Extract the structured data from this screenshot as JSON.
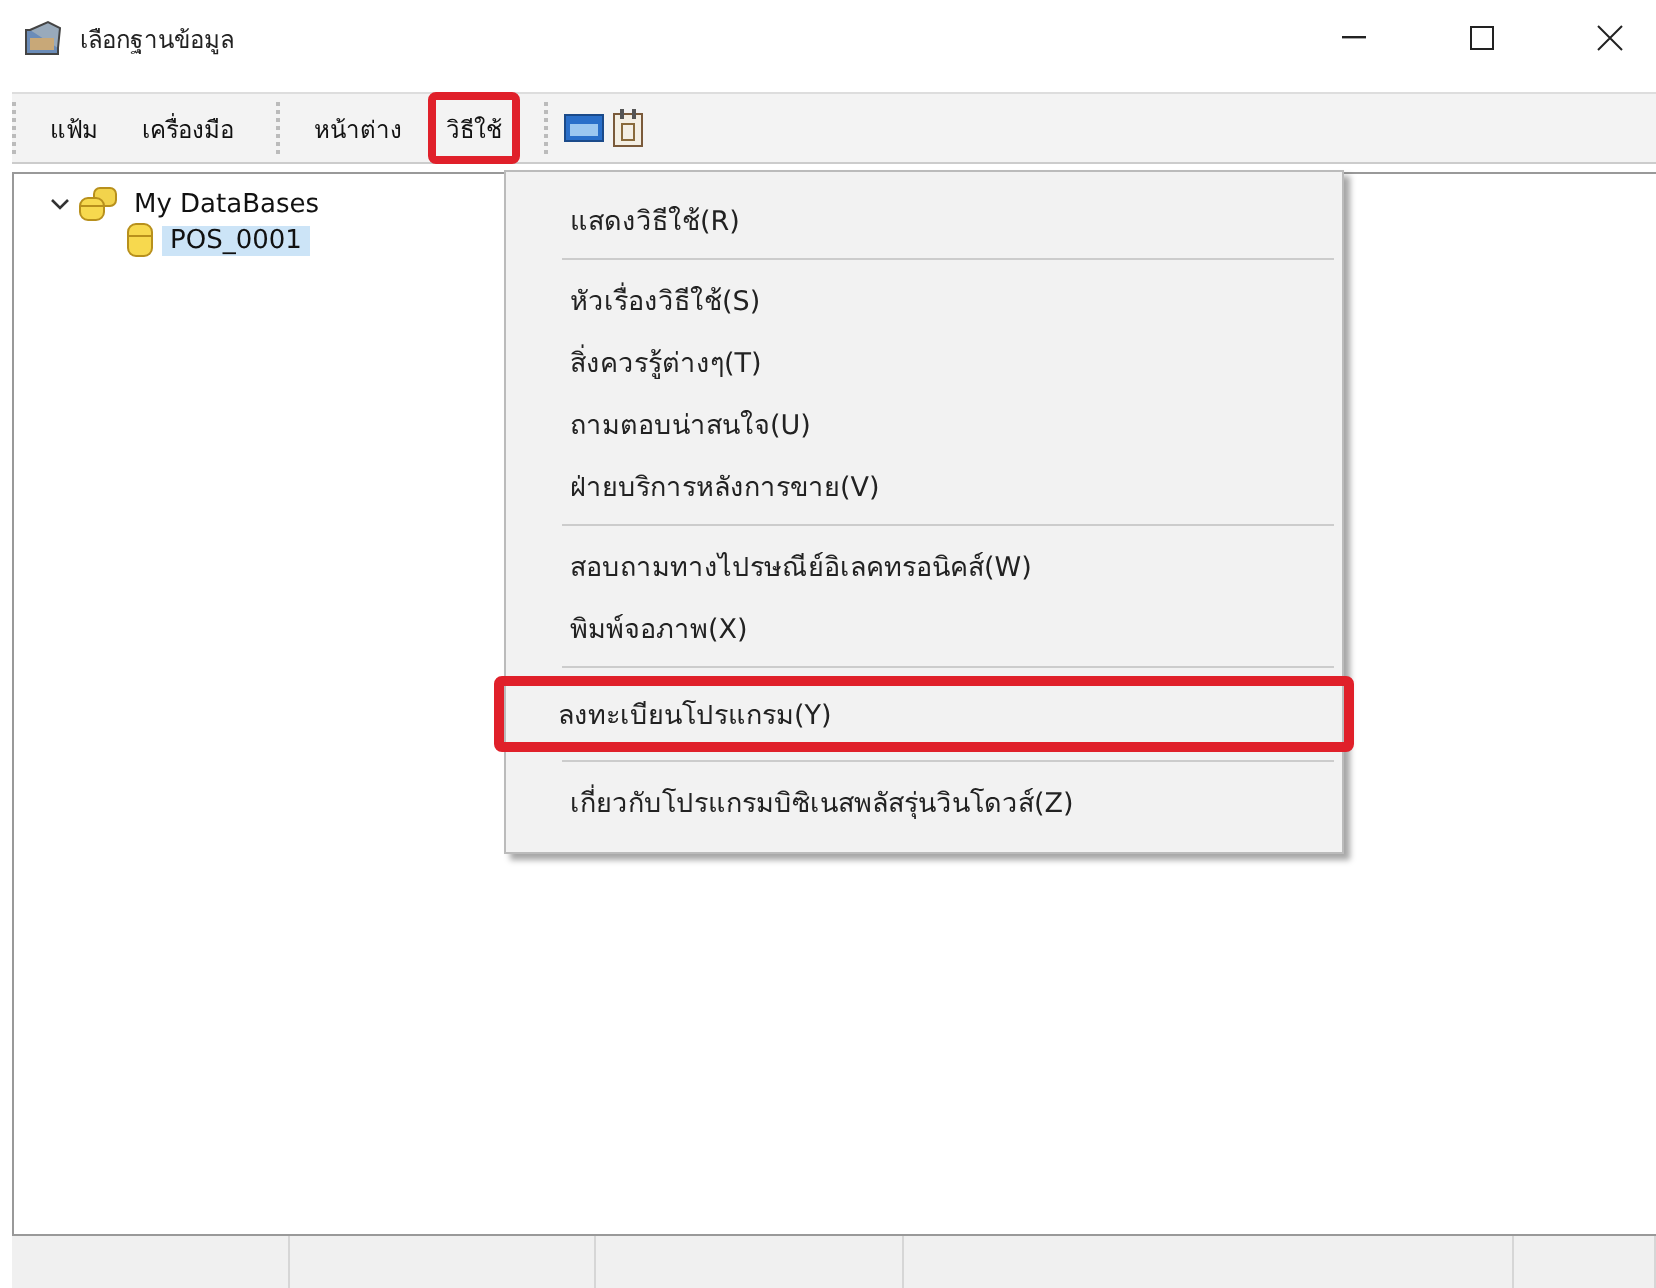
{
  "window": {
    "title": "เลือกฐานข้อมูล"
  },
  "toolbar": {
    "groups": [
      [
        {
          "label": "แฟ้ม",
          "highlighted": false
        },
        {
          "label": "เครื่องมือ",
          "highlighted": false
        }
      ],
      [
        {
          "label": "หน้าต่าง",
          "highlighted": false
        },
        {
          "label": "วิธีใช้",
          "highlighted": true
        }
      ]
    ]
  },
  "tree": [
    {
      "label": "My DataBases",
      "expanded": true,
      "selected": false,
      "children": [
        {
          "label": "POS_0001",
          "selected": true
        }
      ]
    }
  ],
  "menu": {
    "sections": [
      [
        {
          "label": "แสดงวิธีใช้(R)",
          "highlighted": false
        }
      ],
      [
        {
          "label": "หัวเรื่องวิธีใช้(S)",
          "highlighted": false
        },
        {
          "label": "สิ่งควรรู้ต่างๆ(T)",
          "highlighted": false
        },
        {
          "label": "ถามตอบน่าสนใจ(U)",
          "highlighted": false
        },
        {
          "label": "ฝ่ายบริการหลังการขาย(V)",
          "highlighted": false
        }
      ],
      [
        {
          "label": "สอบถามทางไปรษณีย์อิเลคทรอนิคส์(W)",
          "highlighted": false
        },
        {
          "label": "พิมพ์จอภาพ(X)",
          "highlighted": false
        }
      ],
      [
        {
          "label": "ลงทะเบียนโปรแกรม(Y)",
          "highlighted": true
        }
      ],
      [
        {
          "label": "เกี่ยวกับโปรแกรมบิซิเนสพลัสรุ่นวินโดวส์(Z)",
          "highlighted": false
        }
      ]
    ]
  }
}
